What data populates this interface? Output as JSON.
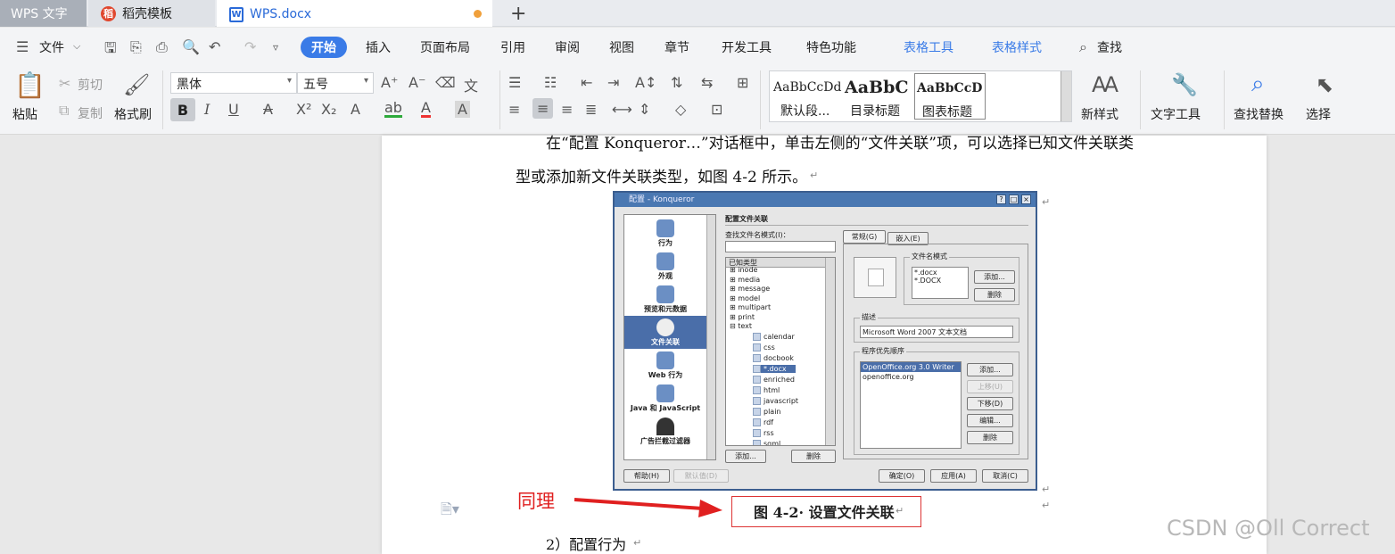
{
  "tabs": {
    "app": "WPS 文字",
    "template": "稻壳模板",
    "document": "WPS.docx",
    "daoke_logo": "稻",
    "w_logo": "W"
  },
  "ribbon": {
    "file_menu": "文件",
    "tabs": [
      "开始",
      "插入",
      "页面布局",
      "引用",
      "审阅",
      "视图",
      "章节",
      "开发工具",
      "特色功能"
    ],
    "context_tabs": [
      "表格工具",
      "表格样式"
    ],
    "search": "查找"
  },
  "tools": {
    "paste": "粘贴",
    "cut": "剪切",
    "copy": "复制",
    "format_painter": "格式刷",
    "font_name": "黑体",
    "font_size": "五号",
    "bold": "B",
    "italic": "I",
    "underline": "U",
    "styles": [
      {
        "sample": "AaBbCcDd",
        "name": "默认段..."
      },
      {
        "sample": "AaBbC",
        "name": "目录标题"
      },
      {
        "sample": "AaBbCcD",
        "name": "图表标题"
      }
    ],
    "new_style": "新样式",
    "text_tools": "文字工具",
    "find_replace": "查找替换",
    "select": "选择"
  },
  "document": {
    "line1": "在“配置 Konqueror…”对话框中，单击左侧的“文件关联”项，可以选择已知文件关联类",
    "line2": "型或添加新文件关联类型，如图 4-2 所示。",
    "caption": "图 4-2· 设置文件关联",
    "line3": "2）配置行为",
    "return_mark": "↵"
  },
  "dialog": {
    "title": "配置 - Konqueror",
    "sidebar": [
      "行为",
      "外观",
      "预览和元数据",
      "文件关联",
      "Web 行为",
      "Java 和 JavaScript",
      "广告拦截过滤器"
    ],
    "section_title": "配置文件关联",
    "find_label": "查找文件名模式(I)：",
    "known_types": "已知类型",
    "tree": [
      "inode",
      "media",
      "message",
      "model",
      "multipart",
      "print",
      "text"
    ],
    "text_children": [
      "calendar",
      "css",
      "docbook",
      "*.docx",
      "enriched",
      "html",
      "javascript",
      "plain",
      "rdf",
      "rss",
      "sgml"
    ],
    "add": "添加...",
    "remove": "删除",
    "tab_general": "常规(G)",
    "tab_embed": "嵌入(E)",
    "pattern_group": "文件名模式",
    "patterns": [
      "*.docx",
      "*.DOCX"
    ],
    "desc_group": "描述",
    "desc_value": "Microsoft Word 2007 文本文档",
    "order_group": "程序优先顺序",
    "apps": [
      "OpenOffice.org 3.0 Writer",
      "openoffice.org"
    ],
    "move_up": "上移(U)",
    "move_down": "下移(D)",
    "edit": "编辑...",
    "help": "帮助(H)",
    "defaults": "默认值(D)",
    "ok": "确定(O)",
    "apply": "应用(A)",
    "cancel": "取消(C)"
  },
  "annotation": "同理",
  "watermark": "CSDN @Oll Correct",
  "colors": {
    "accent": "#3a7be7",
    "annot": "#e02020"
  }
}
